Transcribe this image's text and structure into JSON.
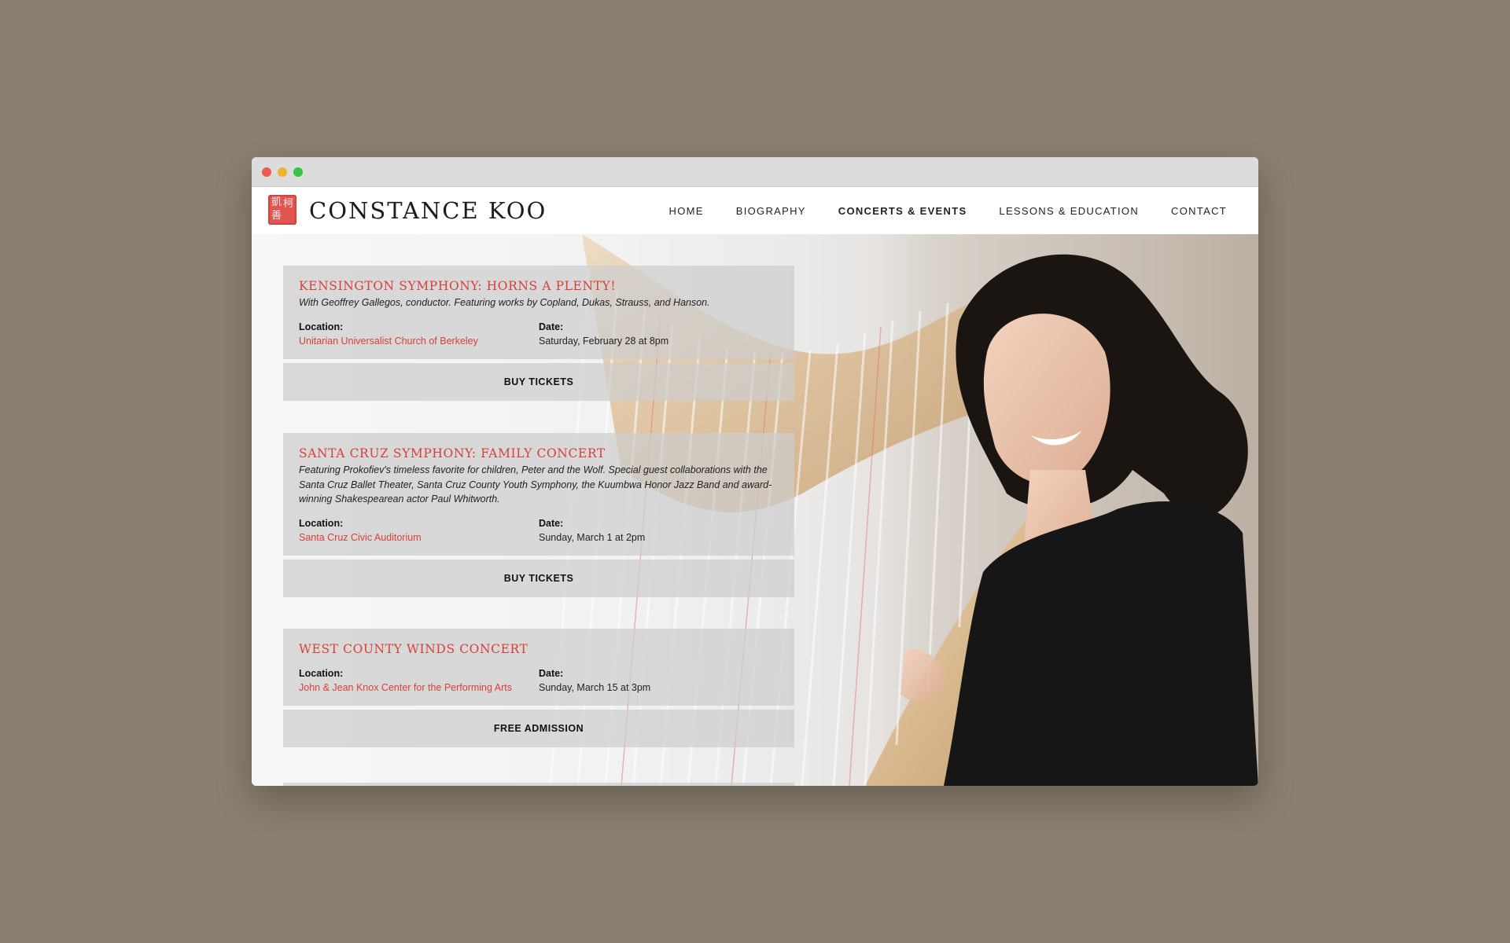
{
  "window": {
    "traffic_lights": [
      "close",
      "minimize",
      "zoom"
    ]
  },
  "header": {
    "site_title": "CONSTANCE KOO",
    "logo_icon": "red-chop-seal",
    "logo_seal_chars": [
      "柯",
      "凱",
      "善"
    ],
    "nav": [
      {
        "label": "HOME",
        "active": false
      },
      {
        "label": "BIOGRAPHY",
        "active": false
      },
      {
        "label": "CONCERTS & EVENTS",
        "active": true
      },
      {
        "label": "LESSONS & EDUCATION",
        "active": false
      },
      {
        "label": "CONTACT",
        "active": false
      }
    ]
  },
  "labels": {
    "location": "Location:",
    "date": "Date:"
  },
  "events": [
    {
      "title": "KENSINGTON SYMPHONY: HORNS A PLENTY!",
      "description": "With Geoffrey Gallegos, conductor. Featuring works by Copland, Dukas, Strauss, and Hanson.",
      "location": "Unitarian Universalist Church of Berkeley",
      "date": "Saturday, February 28 at 8pm",
      "action": "BUY TICKETS"
    },
    {
      "title": "SANTA CRUZ SYMPHONY: FAMILY CONCERT",
      "description": "Featuring Prokofiev's timeless favorite for children, Peter and the Wolf. Special guest collaborations with the Santa Cruz Ballet Theater, Santa Cruz County Youth Symphony, the Kuumbwa Honor Jazz Band and award-winning Shakespearean actor Paul Whitworth.",
      "location": "Santa Cruz Civic Auditorium",
      "date": "Sunday, March 1 at 2pm",
      "action": "BUY TICKETS"
    },
    {
      "title": "WEST COUNTY WINDS CONCERT",
      "description": "",
      "location": "John & Jean Knox Center for the Performing Arts",
      "date": "Sunday, March 15 at 3pm",
      "action": "FREE ADMISSION"
    }
  ],
  "colors": {
    "accent": "#d8403a",
    "background": "#8a7f70"
  },
  "hero_image": "harpist-portrait-photo"
}
